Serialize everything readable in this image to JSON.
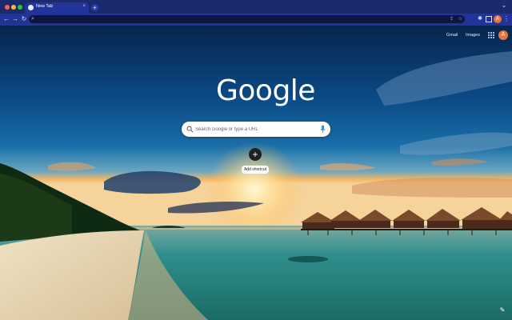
{
  "browser": {
    "tab_title": "New Tab",
    "tab_close": "×",
    "new_tab": "+",
    "omnibox_value": "",
    "profile_initial": "A",
    "window_menu": "⌄"
  },
  "ntp": {
    "toplinks": [
      "Gmail",
      "Images"
    ],
    "logo_text": "Google",
    "search_placeholder": "Search Google or type a URL",
    "shortcut_icon": "+",
    "shortcut_label": "Add shortcut",
    "avatar_initial": "A"
  },
  "icons": {
    "back": "back-arrow-icon",
    "forward": "forward-arrow-icon",
    "reload": "reload-icon",
    "search": "search-icon",
    "mic": "microphone-icon",
    "customize": "pencil-icon"
  },
  "colors": {
    "chrome_accent": "#22349a",
    "titlebar": "#1a2a6c",
    "avatar": "#e8743b"
  }
}
